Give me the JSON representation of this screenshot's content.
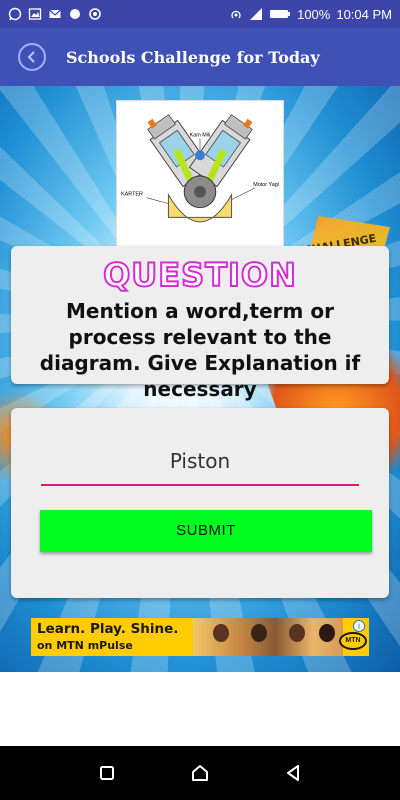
{
  "status_bar": {
    "battery": "100%",
    "time": "10:04 PM",
    "icons_left": [
      "whatsapp-icon",
      "image-icon",
      "mail-icon",
      "circle-icon",
      "settings-icon"
    ],
    "icons_right": [
      "hotspot-icon",
      "signal-icon",
      "battery-icon"
    ]
  },
  "app_bar": {
    "title": "Schools Challenge for Today",
    "back_icon": "back-arrow-icon"
  },
  "diagram": {
    "labels": {
      "top": "Kam Mili",
      "left": "KARTER",
      "right": "Motor Yagi"
    }
  },
  "background": {
    "badge_text": "CHALLENGE"
  },
  "question_card": {
    "heading": "QUESTION",
    "text": "Mention a word,term or process relevant to the diagram. Give Explanation if necessary"
  },
  "answer_card": {
    "answer_value": "Piston",
    "submit_label": "SUBMIT",
    "accent_color": "#e01a7b",
    "button_color": "#00ff21"
  },
  "ad_banner": {
    "line1": "Learn. Play. Shine.",
    "line2": "on MTN mPulse",
    "logo_text": "MTN",
    "info_icon": "info-icon"
  },
  "nav_bar": {
    "buttons": [
      "recent-apps-icon",
      "home-icon",
      "back-icon"
    ]
  },
  "colors": {
    "status_bar": "#3b46a8",
    "app_bar": "#3f51b5",
    "question_heading": "#d62bd6"
  }
}
